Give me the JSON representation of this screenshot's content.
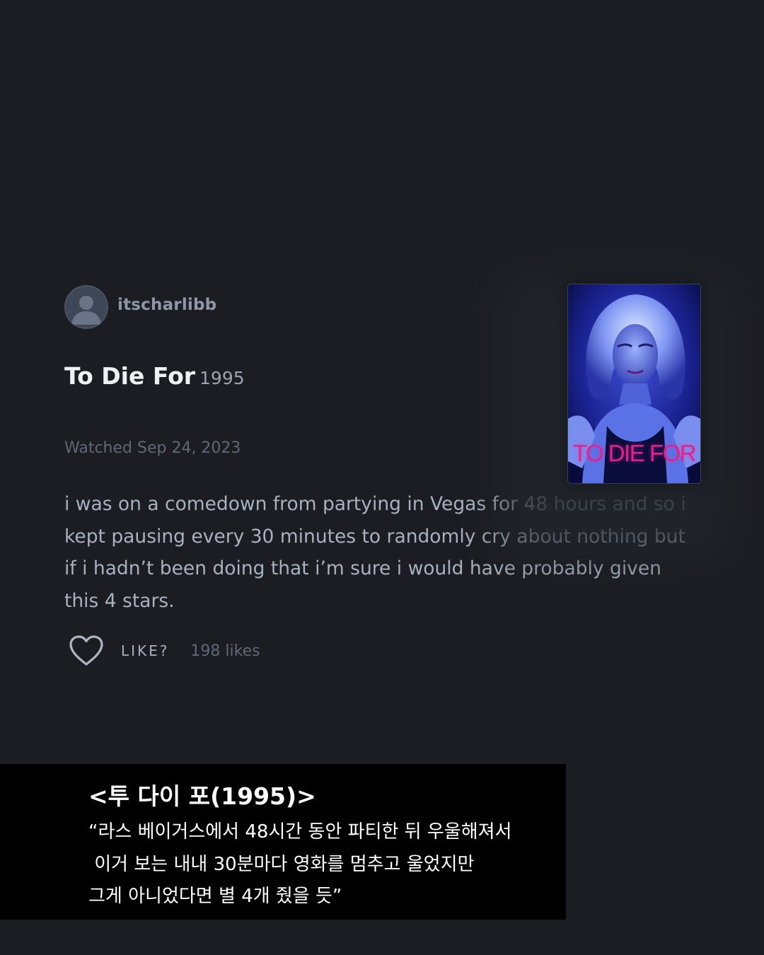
{
  "review": {
    "username": "itscharlibb",
    "film_title": "To Die For",
    "film_year": "1995",
    "watched": "Watched Sep 24, 2023",
    "text": "i was on a comedown from partying in Vegas for 48 hours and so i kept pausing every 30 minutes to randomly cry about nothing but if i hadn’t been doing that i’m sure i would have probably given this 4 stars.",
    "like_label": "LIKE?",
    "likes_count": "198 likes"
  },
  "poster": {
    "title_text": "TO DIE FOR",
    "icon": "movie-poster"
  },
  "caption": {
    "title": "<투 다이 포(1995)>",
    "lines": [
      "“라스 베이거스에서 48시간 동안 파티한 뒤 우울해져서",
      " 이거 보는 내내 30분마다 영화를 멈추고 울었지만",
      "그게 아니었다면 별 4개 줬을 듯”"
    ]
  },
  "colors": {
    "background": "#1b1d22",
    "caption_background": "#000000",
    "poster_title": "#e0238c"
  }
}
